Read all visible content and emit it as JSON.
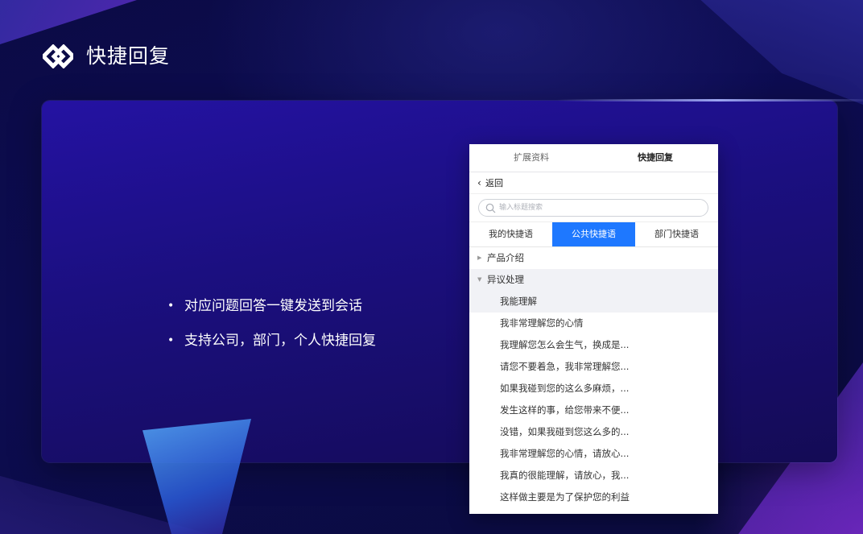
{
  "slide": {
    "title": "快捷回复",
    "logo_icon": "double-diamond-logo",
    "bullets": [
      "对应问题回答一键发送到会话",
      "支持公司，部门，个人快捷回复"
    ]
  },
  "app": {
    "top_tabs": [
      "扩展资料",
      "快捷回复"
    ],
    "active_top_tab": "快捷回复",
    "back_label": "返回",
    "search": {
      "placeholder": "输入标题搜索",
      "value": ""
    },
    "segment_tabs": [
      "我的快捷语",
      "公共快捷语",
      "部门快捷语"
    ],
    "active_segment": "公共快捷语",
    "accent_color": "#1e78ff",
    "categories": [
      {
        "label": "产品介绍",
        "expanded": false
      },
      {
        "label": "异议处理",
        "expanded": true,
        "items": [
          "我能理解",
          "我非常理解您的心情",
          "我理解您怎么会生气，换成是...",
          "请您不要着急，我非常理解您...",
          "如果我碰到您的这么多麻烦，...",
          "发生这样的事，给您带来不便...",
          "没错，如果我碰到您这么多的...",
          "我非常理解您的心情，请放心...",
          "我真的很能理解，请放心，我...",
          "这样做主要是为了保护您的利益"
        ],
        "selected_item": "我能理解"
      }
    ]
  }
}
